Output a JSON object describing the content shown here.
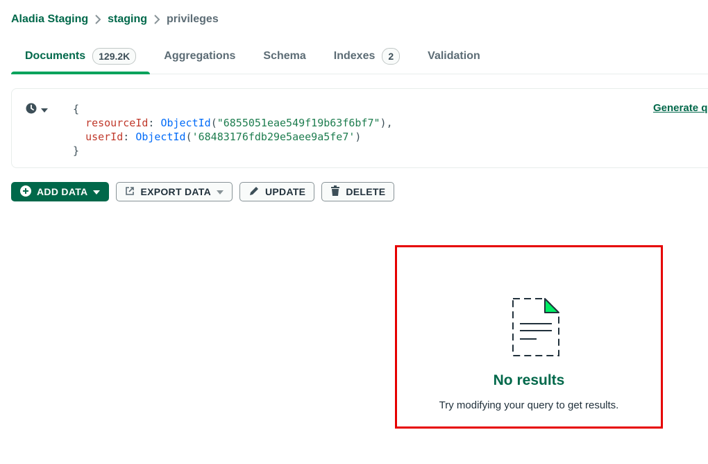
{
  "breadcrumb": {
    "items": [
      "Aladia Staging",
      "staging",
      "privileges"
    ]
  },
  "tabs": [
    {
      "label": "Documents",
      "badge": "129.2K",
      "active": true
    },
    {
      "label": "Aggregations"
    },
    {
      "label": "Schema"
    },
    {
      "label": "Indexes",
      "badge": "2"
    },
    {
      "label": "Validation"
    }
  ],
  "query": {
    "open_brace": "{",
    "close_brace": "}",
    "line1": {
      "key": "resourceId",
      "fn": "ObjectId",
      "arg": "\"6855051eae549f19b63f6bf7\"",
      "tail": ","
    },
    "line2": {
      "key": "userId",
      "fn": "ObjectId",
      "arg": "'68483176fdb29e5aee9a5fe7'",
      "tail": ""
    },
    "generate_label": "Generate query"
  },
  "toolbar": {
    "add_label": "ADD DATA",
    "export_label": "EXPORT DATA",
    "update_label": "UPDATE",
    "delete_label": "DELETE"
  },
  "empty_state": {
    "title": "No results",
    "description": "Try modifying your query to get results."
  },
  "colors": {
    "brand_green": "#00684a",
    "accent_green": "#00a35c",
    "highlight_red": "#e60000"
  },
  "icons": {
    "history": "clock-icon",
    "add": "plus-circle-icon",
    "export": "export-icon",
    "update": "pencil-icon",
    "delete": "trash-icon",
    "empty": "empty-document-icon"
  }
}
